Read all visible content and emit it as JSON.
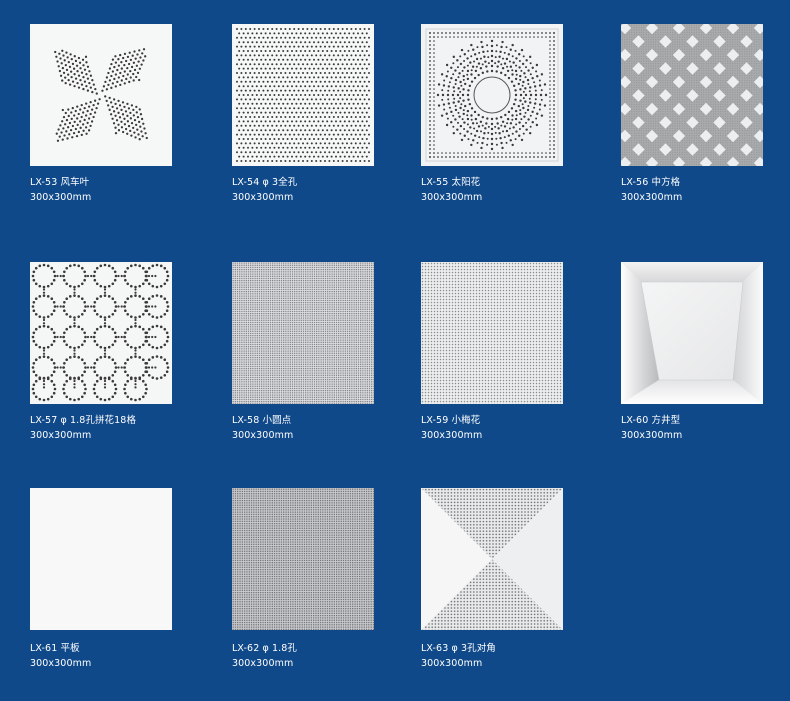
{
  "products": [
    {
      "code_name": "LX-53 风车叶",
      "size": "300x300mm",
      "pattern": "windmill"
    },
    {
      "code_name": "LX-54 φ 3全孔",
      "size": "300x300mm",
      "pattern": "full-holes-3mm"
    },
    {
      "code_name": "LX-55 太阳花",
      "size": "300x300mm",
      "pattern": "sunflower"
    },
    {
      "code_name": "LX-56 中方格",
      "size": "300x300mm",
      "pattern": "medium-checker"
    },
    {
      "code_name": "LX-57 φ 1.8孔拼花18格",
      "size": "300x300mm",
      "pattern": "circle-grid"
    },
    {
      "code_name": "LX-58 小圆点",
      "size": "300x300mm",
      "pattern": "fine-dots"
    },
    {
      "code_name": "LX-59 小梅花",
      "size": "300x300mm",
      "pattern": "small-plum-holes"
    },
    {
      "code_name": "LX-60 方井型",
      "size": "300x300mm",
      "pattern": "square-well"
    },
    {
      "code_name": "LX-61 平板",
      "size": "300x300mm",
      "pattern": "plain"
    },
    {
      "code_name": "LX-62 φ 1.8孔",
      "size": "300x300mm",
      "pattern": "holes-1.8mm"
    },
    {
      "code_name": "LX-63 φ 3孔对角",
      "size": "300x300mm",
      "pattern": "diagonal-holes"
    }
  ],
  "colors": {
    "background": "#10498a",
    "panel": "#f4f5f6",
    "perforation": "#3a3a3a"
  }
}
